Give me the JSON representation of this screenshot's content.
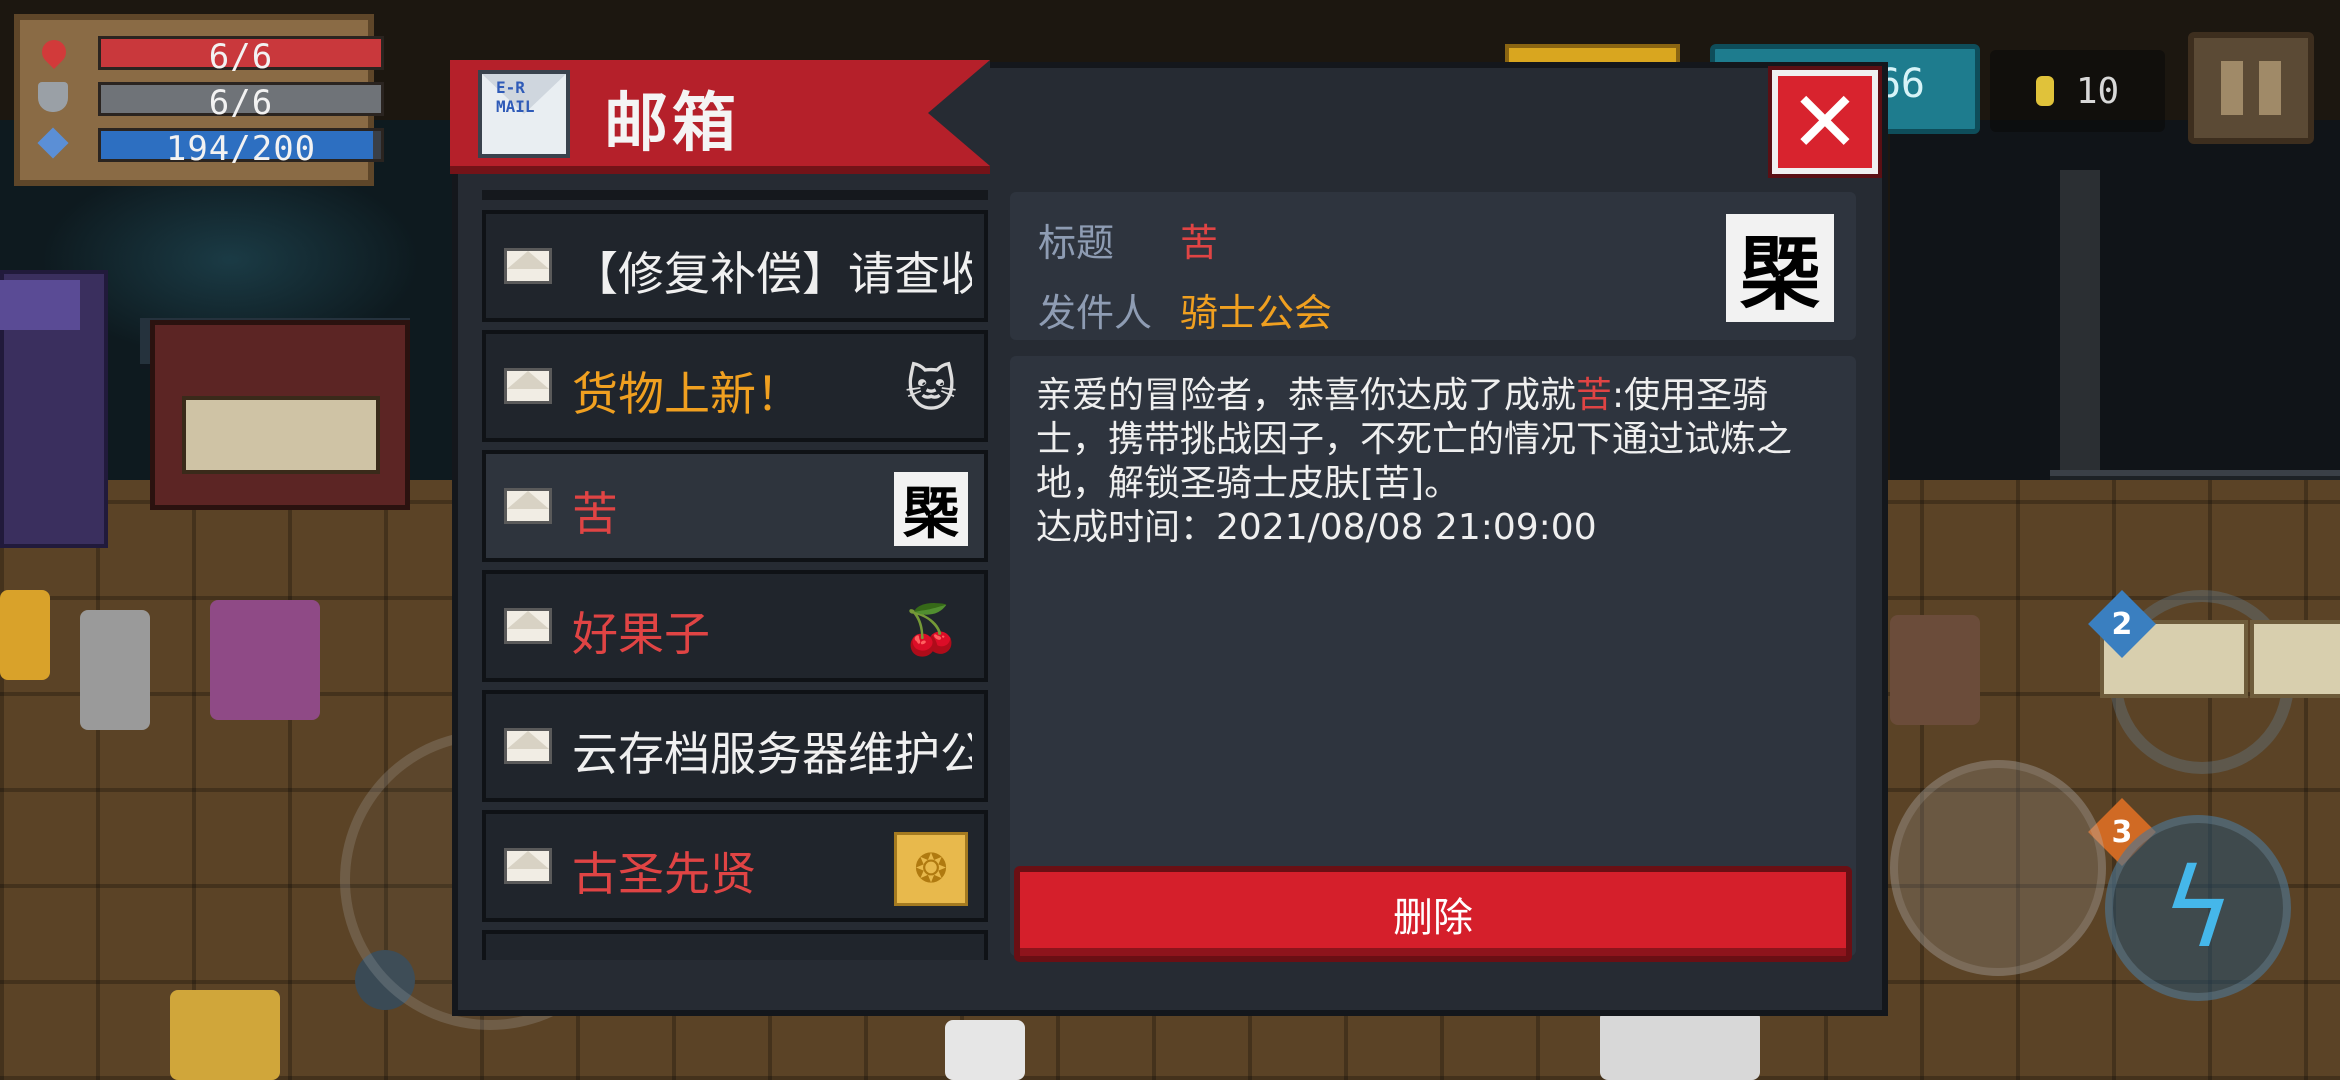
{
  "hud": {
    "hp": "6/6",
    "armor": "6/6",
    "energy": "194/200",
    "hp_fraction": 1.0,
    "armor_fraction": 1.0,
    "energy_fraction": 0.97,
    "gems": "66",
    "coins": "10",
    "colors": {
      "hp": "#c9383c",
      "armor": "#6f7378",
      "energy": "#2d6fc1"
    }
  },
  "mailbox": {
    "title": "邮箱",
    "icon_text": "E-R MAIL",
    "close_label": "✕",
    "items": [
      {
        "label": "【修复补偿】请查收",
        "color": "#f0f0f0",
        "icon": "none"
      },
      {
        "label": "货物上新！",
        "color": "#f0a020",
        "icon": "cat-icon"
      },
      {
        "label": "苦",
        "color": "#e04444",
        "icon": "ku-seal-icon"
      },
      {
        "label": "好果子",
        "color": "#e04444",
        "icon": "cherry-icon"
      },
      {
        "label": "云存档服务器维护公告",
        "color": "#f0f0f0",
        "icon": "none"
      },
      {
        "label": "古圣先贤",
        "color": "#e04444",
        "icon": "gold-seal-icon"
      }
    ],
    "thumb_glyphs": {
      "cat": "🐱",
      "ku": "㮣",
      "cherry": "🍒",
      "seal": "❂"
    },
    "detail": {
      "title_label": "标题",
      "title_value": "苦",
      "sender_label": "发件人",
      "sender_value": "骑士公会",
      "thumb_glyph": "㮣",
      "body_line1_a": "亲爱的冒险者，恭喜你达成了成就",
      "body_line1_hl": "苦",
      "body_line1_b": ":使用圣骑士，携带挑战因子，不死亡的情况下通过试炼之地，解锁圣骑士皮肤[苦]。",
      "body_line2": "达成时间：2021/08/08 21:09:00",
      "delete_label": "删除"
    }
  }
}
